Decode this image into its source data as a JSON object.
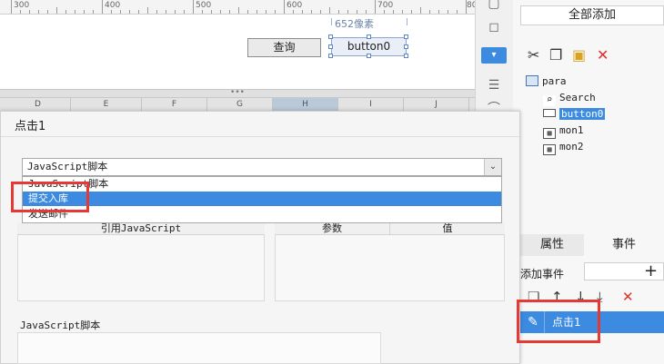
{
  "canvas": {
    "ruler_labels": [
      "300",
      "400",
      "500",
      "600",
      "700",
      "80"
    ],
    "dimension_label": "652像素",
    "query_button": "查询",
    "selected_button": "button0",
    "splitter_dots": "•••",
    "grid_columns": [
      "D",
      "E",
      "F",
      "G",
      "H",
      "I",
      "J"
    ]
  },
  "right_panel": {
    "add_all": "全部添加",
    "toolbar_icons": [
      "cut-icon",
      "copy-icon",
      "paste-icon",
      "delete-icon"
    ],
    "tree": [
      {
        "label": "para",
        "icon": "form-icon"
      },
      {
        "label": "Search",
        "icon": "search-icon"
      },
      {
        "label": "button0",
        "icon": "button-icon",
        "selected": true
      },
      {
        "label": "mon1",
        "icon": "grid-icon"
      },
      {
        "label": "mon2",
        "icon": "grid-icon"
      }
    ],
    "tabs": [
      "属性",
      "事件"
    ],
    "active_tab": "事件",
    "add_event_label": "添加事件",
    "add_event_plus": "+",
    "event_toolbar_icons": [
      "new-icon",
      "up-arrow-icon",
      "down-arrow-icon",
      "bottom-arrow-icon",
      "delete-icon"
    ],
    "events": [
      {
        "name": "点击1"
      }
    ]
  },
  "dialog": {
    "title": "点击1",
    "script_type_value": "JavaScript脚本",
    "options": [
      "JavaScript脚本",
      "提交入库",
      "发送邮件"
    ],
    "highlighted_option": "提交入库",
    "ref_js_header": "引用JavaScript",
    "param_headers": [
      "参数",
      "值"
    ],
    "js_script_label": "JavaScript脚本"
  },
  "colors": {
    "selection": "#3c8be0",
    "highlight_box": "#e53935",
    "delete_red": "#e0302a"
  }
}
